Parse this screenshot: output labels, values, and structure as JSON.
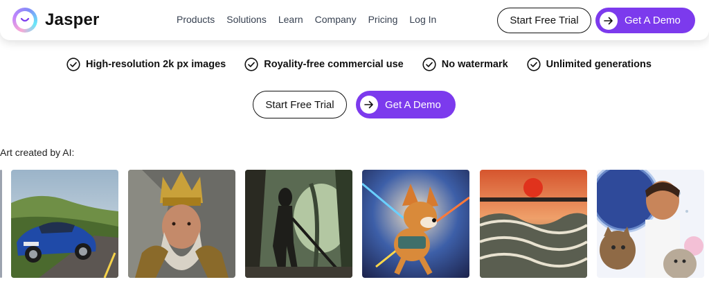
{
  "brand": {
    "name": "Jasper"
  },
  "nav": {
    "links": [
      "Products",
      "Solutions",
      "Learn",
      "Company",
      "Pricing",
      "Log In"
    ],
    "trial_label": "Start Free Trial",
    "demo_label": "Get A Demo"
  },
  "features": [
    "High-resolution 2k px images",
    "Royality-free commercial use",
    "No watermark",
    "Unlimited generations"
  ],
  "cta": {
    "trial_label": "Start Free Trial",
    "demo_label": "Get A Demo"
  },
  "gallery": {
    "label": "Art created by AI:",
    "images": [
      "car-image",
      "king-image",
      "forest-creature-image",
      "corgi-image",
      "sunset-sea-image",
      "man-with-kittens-image"
    ]
  },
  "colors": {
    "accent": "#7c3aed",
    "text": "#111827"
  }
}
